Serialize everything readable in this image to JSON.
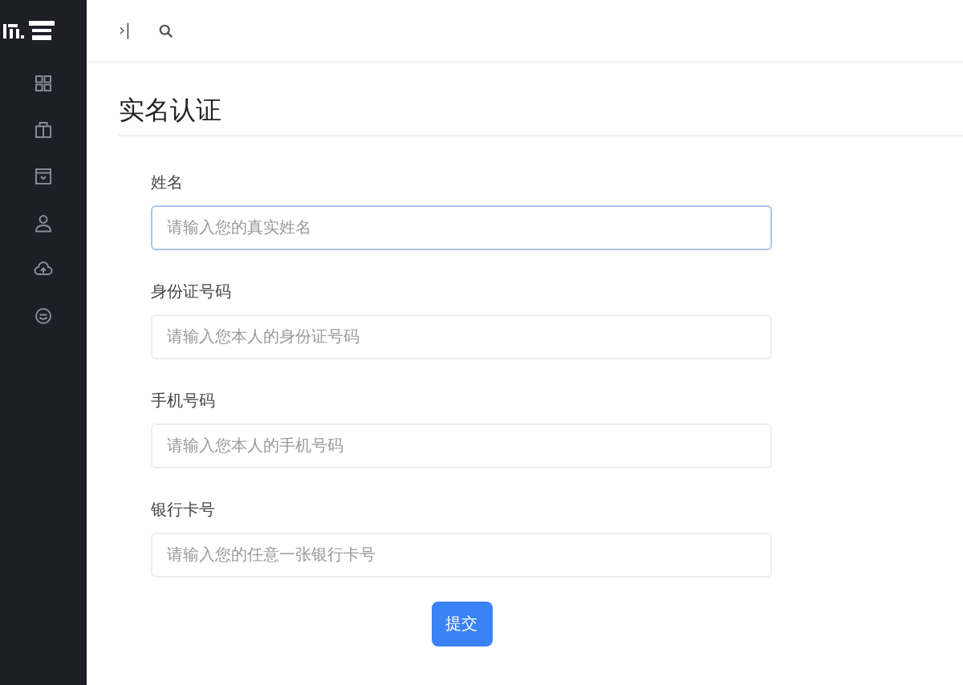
{
  "sidebar": {
    "items": [
      {
        "kind": "grid"
      },
      {
        "kind": "bag"
      },
      {
        "kind": "box"
      },
      {
        "kind": "user"
      },
      {
        "kind": "cloud"
      },
      {
        "kind": "face"
      }
    ]
  },
  "topbar": {
    "toggle": "›|"
  },
  "page": {
    "title": "实名认证"
  },
  "form": {
    "fields": [
      {
        "label": "姓名",
        "placeholder": "请输入您的真实姓名",
        "focused": true
      },
      {
        "label": "身份证号码",
        "placeholder": "请输入您本人的身份证号码",
        "focused": false
      },
      {
        "label": "手机号码",
        "placeholder": "请输入您本人的手机号码",
        "focused": false
      },
      {
        "label": "银行卡号",
        "placeholder": "请输入您的任意一张银行卡号",
        "focused": false
      }
    ],
    "submit": "提交"
  }
}
